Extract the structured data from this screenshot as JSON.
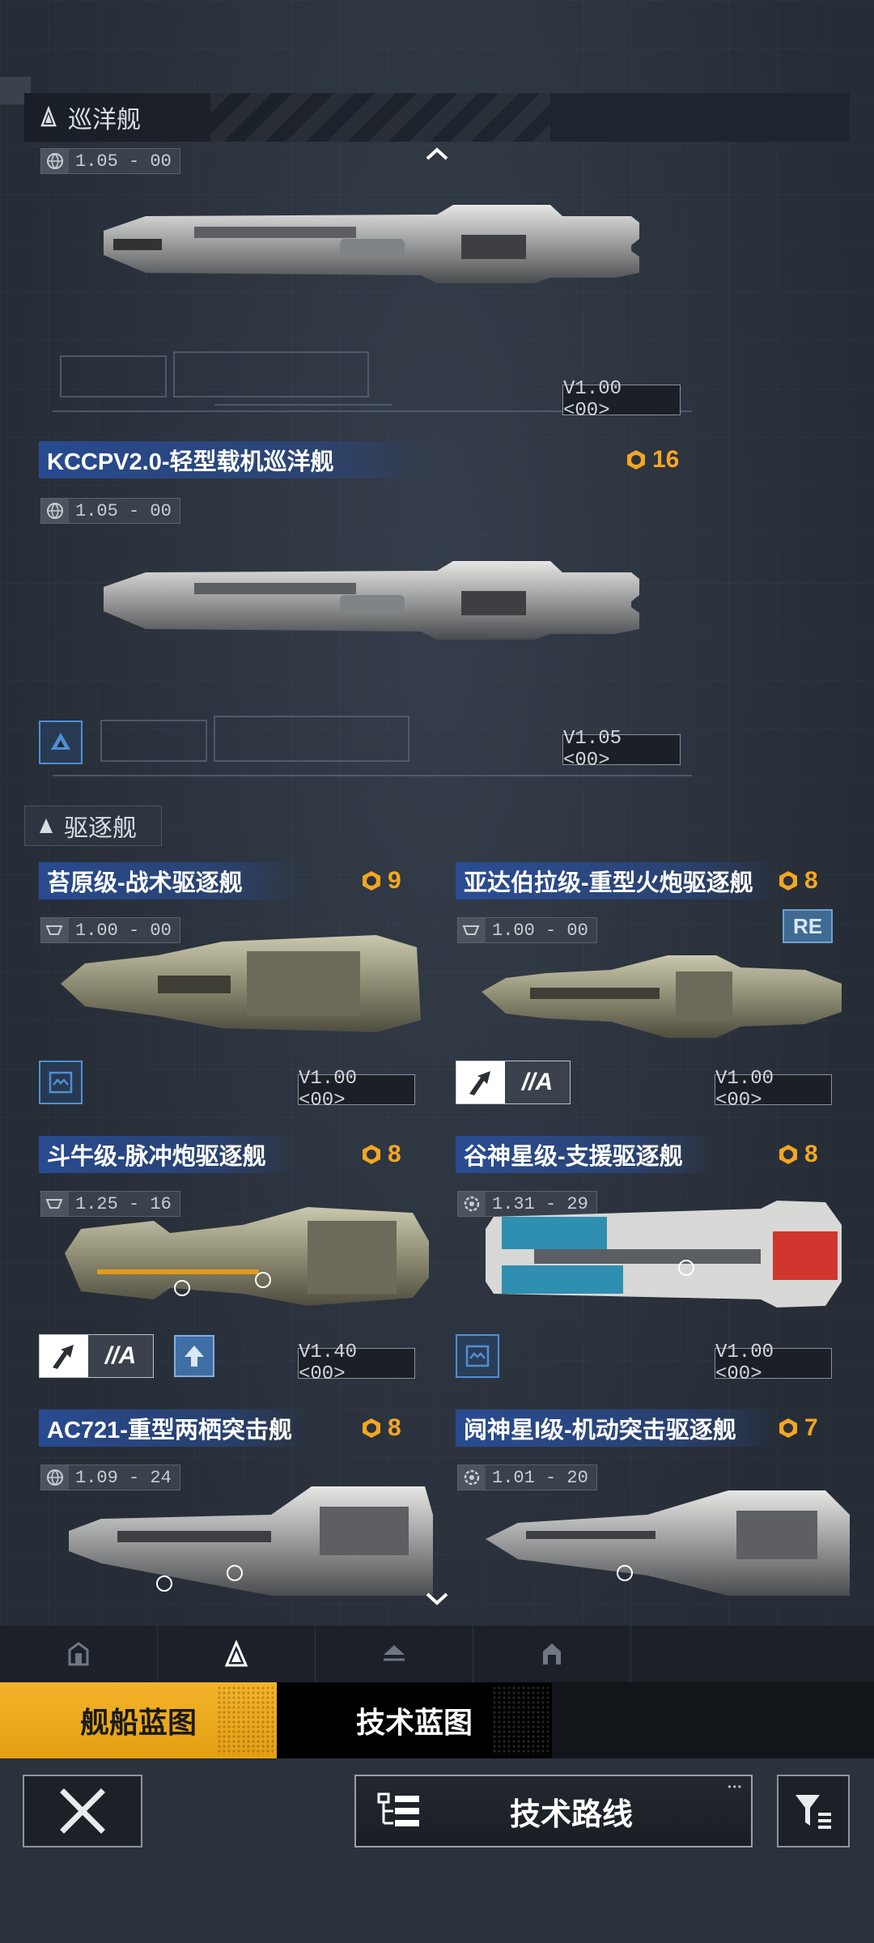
{
  "sections": {
    "cruiser": {
      "label": "巡洋舰",
      "icon": "cruiser-class-icon"
    },
    "destroyer": {
      "label": "驱逐舰",
      "icon": "destroyer-class-icon"
    }
  },
  "colors": {
    "cost": "#f3a721",
    "title_strip": "#2850a0",
    "active_tab": "#f3b32a",
    "role_badge": "#4f8fd6"
  },
  "cards": {
    "cruiser_top": {
      "tier": "1.05 - 00",
      "tier_icon": "globe-icon",
      "version": "V1.00 <00>"
    },
    "kccpv": {
      "title": "KCCPV2.0-轻型载机巡洋舰",
      "cost": "16",
      "tier": "1.05 - 00",
      "tier_icon": "globe-icon",
      "version": "V1.05 <00>",
      "role_icon": "carrier-role-icon"
    },
    "tai_yuan": {
      "title": "苔原级-战术驱逐舰",
      "cost": "9",
      "tier": "1.00 - 00",
      "tier_icon": "faction-emblem-icon",
      "version": "V1.00 <00>",
      "role_icon": "support-role-icon"
    },
    "adaberla": {
      "title": "亚达伯拉级-重型火炮驱逐舰",
      "cost": "8",
      "tier": "1.00 - 00",
      "tier_icon": "faction-emblem-icon",
      "version": "V1.00 <00>",
      "re_badge": "RE",
      "a_badge": "//A"
    },
    "dou_niu": {
      "title": "斗牛级-脉冲炮驱逐舰",
      "cost": "8",
      "tier": "1.25 - 16",
      "tier_icon": "faction-emblem-icon",
      "version": "V1.40 <00>",
      "a_badge": "//A"
    },
    "gu_shen": {
      "title": "谷神星级-支援驱逐舰",
      "cost": "8",
      "tier": "1.31 - 29",
      "tier_icon": "gear-emblem-icon",
      "version": "V1.00 <00>",
      "role_icon": "support-role-icon"
    },
    "ac721": {
      "title": "AC721-重型两栖突击舰",
      "cost": "8",
      "tier": "1.09 - 24",
      "tier_icon": "globe-icon"
    },
    "yue_shen": {
      "title": "阋神星I级-机动突击驱逐舰",
      "cost": "7",
      "tier": "1.01 - 20",
      "tier_icon": "gear-emblem-icon"
    }
  },
  "bottom_nav": {
    "icons": [
      "frigate-class-icon",
      "cruiser-class-icon",
      "carrier-class-icon",
      "battleship-class-icon"
    ],
    "active_index": 1
  },
  "tabs": {
    "ship_blueprint": "舰船蓝图",
    "tech_blueprint": "技术蓝图"
  },
  "toolbar": {
    "tech_route": "技术路线",
    "close_icon": "close-icon",
    "filter_icon": "filter-icon"
  }
}
